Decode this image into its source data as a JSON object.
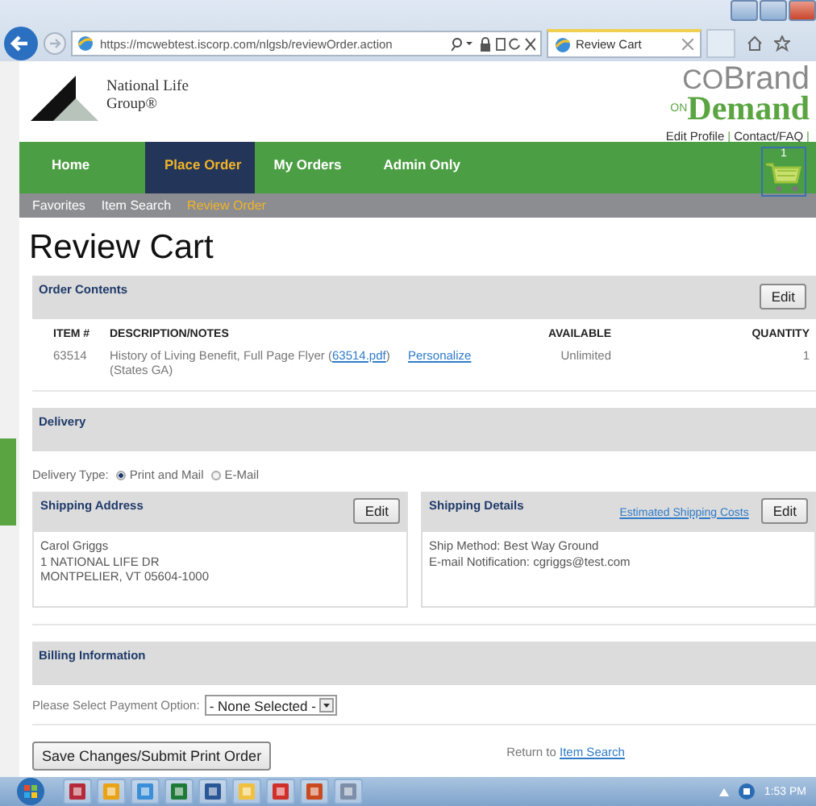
{
  "browser": {
    "url": "https://mcwebtest.iscorp.com/nlgsb/reviewOrder.action",
    "tab_title": "Review Cart"
  },
  "header": {
    "logo_lines": [
      "National Life",
      "Group®"
    ],
    "brand_top": "CO",
    "brand_top2": "Brand",
    "brand_on": "ON",
    "brand_bottom": "Demand",
    "links": [
      "Edit Profile",
      "Contact/FAQ"
    ],
    "link_separator": "|",
    "cart_count": "1"
  },
  "nav": [
    {
      "label": "Home",
      "selected": false
    },
    {
      "label": "Place Order",
      "selected": true
    },
    {
      "label": "My Orders",
      "selected": false
    },
    {
      "label": "Admin Only",
      "selected": false
    }
  ],
  "subnav": [
    {
      "label": "Favorites",
      "selected": false
    },
    {
      "label": "Item Search",
      "selected": false
    },
    {
      "label": "Review Order",
      "selected": true
    }
  ],
  "page_title": "Review Cart",
  "order_contents": {
    "title": "Order Contents",
    "button": "Edit",
    "columns": [
      "ITEM #",
      "DESCRIPTION/NOTES",
      "AVAILABLE",
      "QUANTITY"
    ],
    "rows": [
      {
        "item": "63514",
        "description": "History of Living Benefit, Full Page Flyer (",
        "file_link": "63514.pdf",
        "description_end": ")",
        "note": "(States GA)",
        "action": "Personalize",
        "available": "Unlimited",
        "quantity": "1"
      }
    ]
  },
  "delivery": {
    "title": "Delivery",
    "type_label": "Delivery Type:",
    "options": [
      {
        "label": "Print and Mail",
        "selected": true
      },
      {
        "label": "E-Mail",
        "selected": false
      }
    ],
    "shipping_address": {
      "title": "Shipping Address",
      "button": "Edit",
      "lines": [
        "Carol Griggs",
        "1 NATIONAL LIFE DR",
        "MONTPELIER, VT 05604-1000"
      ]
    },
    "shipping_details": {
      "title": "Shipping Details",
      "link": "Estimated Shipping Costs",
      "button": "Edit",
      "lines": [
        "Ship Method: Best Way Ground",
        "E-mail Notification: cgriggs@test.com"
      ]
    }
  },
  "billing": {
    "title": "Billing Information",
    "label": "Please Select Payment Option:",
    "select_value": "- None Selected -"
  },
  "submit_button": "Save Changes/Submit Print Order",
  "return_text": "Return to",
  "return_link": "Item Search",
  "taskbar": {
    "clock": "1:53 PM"
  }
}
